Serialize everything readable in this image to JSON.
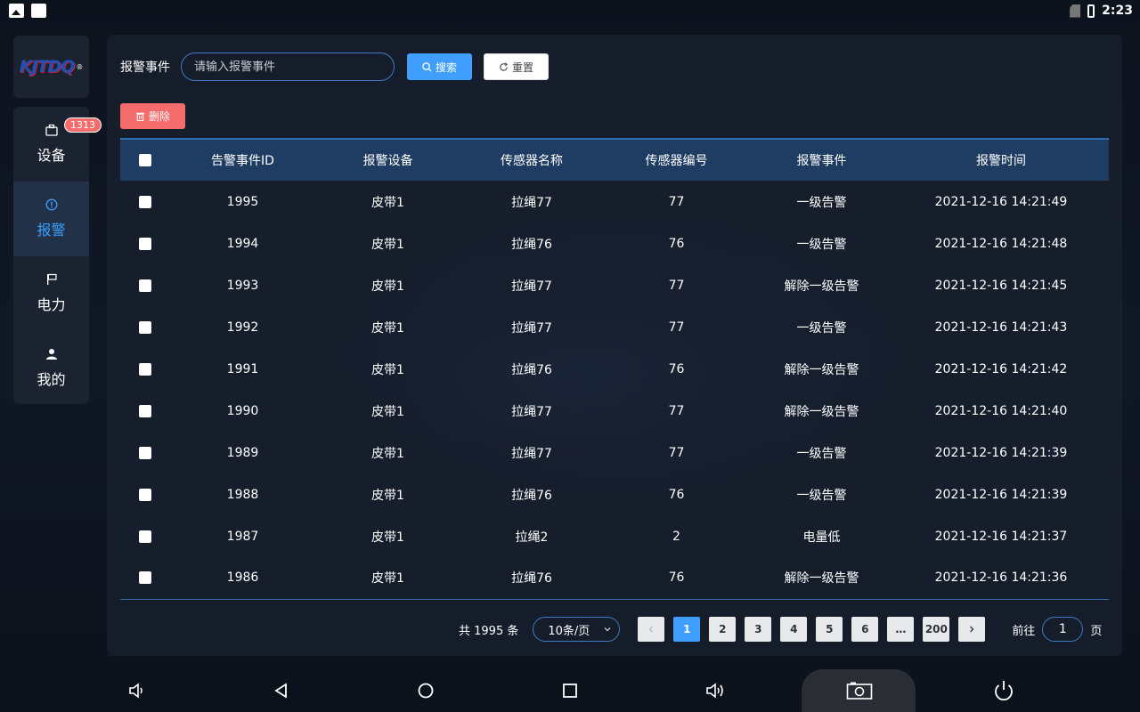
{
  "status_bar": {
    "time": "2:23"
  },
  "sidebar": {
    "logo": "KJTDQ",
    "items": [
      {
        "label": "设备",
        "icon": "briefcase-icon",
        "badge": "1313",
        "active": false
      },
      {
        "label": "报警",
        "icon": "alert-circle-icon",
        "active": true
      },
      {
        "label": "电力",
        "icon": "flag-icon",
        "active": false
      },
      {
        "label": "我的",
        "icon": "user-icon",
        "active": false
      }
    ]
  },
  "search": {
    "label": "报警事件",
    "placeholder": "请输入报警事件",
    "search_button": "搜索",
    "reset_button": "重置",
    "delete_button": "删除"
  },
  "table": {
    "headers": [
      "告警事件ID",
      "报警设备",
      "传感器名称",
      "传感器编号",
      "报警事件",
      "报警时间"
    ],
    "rows": [
      [
        "1995",
        "皮带1",
        "拉绳77",
        "77",
        "一级告警",
        "2021-12-16 14:21:49"
      ],
      [
        "1994",
        "皮带1",
        "拉绳76",
        "76",
        "一级告警",
        "2021-12-16 14:21:48"
      ],
      [
        "1993",
        "皮带1",
        "拉绳77",
        "77",
        "解除一级告警",
        "2021-12-16 14:21:45"
      ],
      [
        "1992",
        "皮带1",
        "拉绳77",
        "77",
        "一级告警",
        "2021-12-16 14:21:43"
      ],
      [
        "1991",
        "皮带1",
        "拉绳76",
        "76",
        "解除一级告警",
        "2021-12-16 14:21:42"
      ],
      [
        "1990",
        "皮带1",
        "拉绳77",
        "77",
        "解除一级告警",
        "2021-12-16 14:21:40"
      ],
      [
        "1989",
        "皮带1",
        "拉绳77",
        "77",
        "一级告警",
        "2021-12-16 14:21:39"
      ],
      [
        "1988",
        "皮带1",
        "拉绳76",
        "76",
        "一级告警",
        "2021-12-16 14:21:39"
      ],
      [
        "1987",
        "皮带1",
        "拉绳2",
        "2",
        "电量低",
        "2021-12-16 14:21:37"
      ],
      [
        "1986",
        "皮带1",
        "拉绳76",
        "76",
        "解除一级告警",
        "2021-12-16 14:21:36"
      ]
    ]
  },
  "pagination": {
    "total": "共 1995 条",
    "page_size": "10条/页",
    "pages": [
      "1",
      "2",
      "3",
      "4",
      "5",
      "6",
      "…",
      "200"
    ],
    "current": "1",
    "goto_label": "前往",
    "goto_value": "1",
    "goto_suffix": "页"
  }
}
